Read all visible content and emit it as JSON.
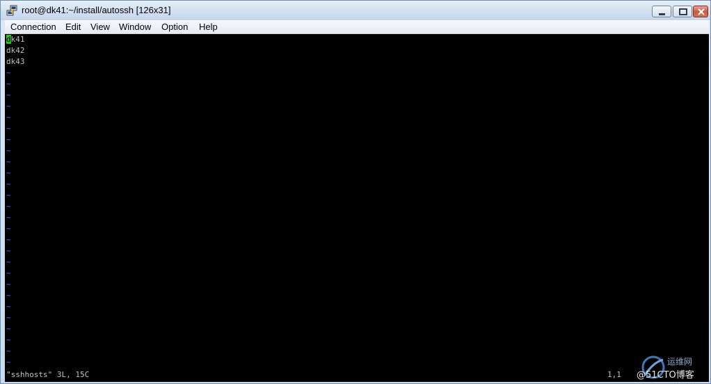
{
  "window": {
    "title": "root@dk41:~/install/autossh [126x31]",
    "icon": "putty-icon",
    "controls": [
      "minimize-icon",
      "maximize-icon",
      "close-icon"
    ]
  },
  "menu": [
    {
      "label": "Connection"
    },
    {
      "label": "Edit"
    },
    {
      "label": "View"
    },
    {
      "label": "Window"
    },
    {
      "label": "Option"
    },
    {
      "label": "Help"
    }
  ],
  "terminal": {
    "cursor_char": "d",
    "lines": [
      "k41",
      "dk42",
      "dk43"
    ],
    "tilde": "~",
    "status_left": "\"sshhosts\" 3L, 15C",
    "status_right": "1,1"
  },
  "watermark": {
    "site": "运维网",
    "blog": "@51CTO博客"
  },
  "colors": {
    "terminal_bg": "#000000",
    "terminal_fg": "#c0c0c0",
    "cursor": "#22c31d",
    "tilde": "#4a5cff"
  }
}
